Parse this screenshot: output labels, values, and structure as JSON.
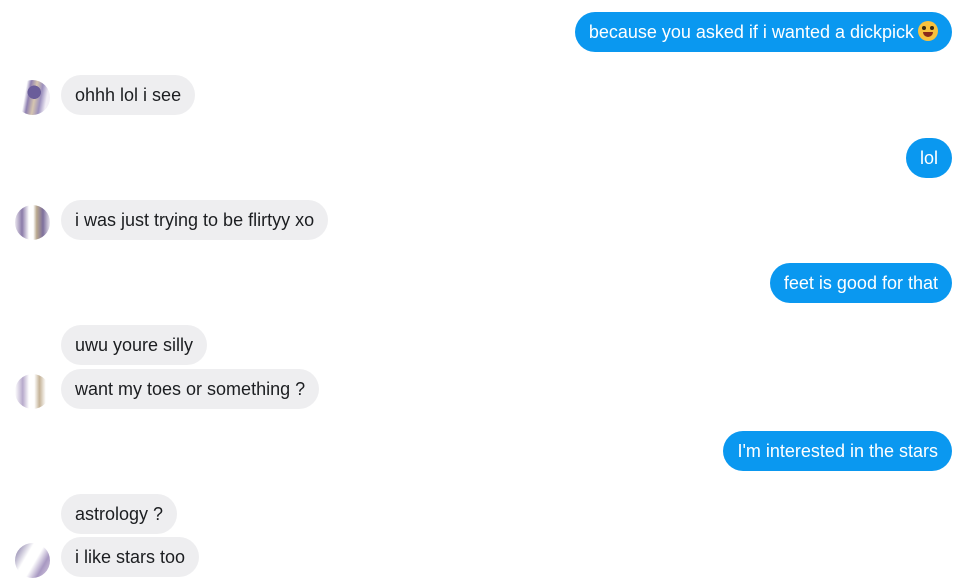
{
  "messages": [
    {
      "dir": "out",
      "text": "because you asked if i wanted a dickpick",
      "emoji": "grinning-squinting-tongue-emoji"
    },
    {
      "dir": "in",
      "text": "ohhh lol i see"
    },
    {
      "dir": "out",
      "text": "lol"
    },
    {
      "dir": "in",
      "text": "i was just trying to be flirtyy xo"
    },
    {
      "dir": "out",
      "text": "feet is good for that"
    },
    {
      "dir": "in",
      "text": "uwu youre silly"
    },
    {
      "dir": "in",
      "text": "want my toes or something ?"
    },
    {
      "dir": "out",
      "text": "I'm interested in the stars"
    },
    {
      "dir": "in",
      "text": "astrology ?"
    },
    {
      "dir": "in",
      "text": "i like stars too"
    }
  ],
  "colors": {
    "outgoing_bubble": "#0a98f0",
    "incoming_bubble": "#eeeef0",
    "outgoing_text": "#ffffff",
    "incoming_text": "#1c1e21"
  }
}
